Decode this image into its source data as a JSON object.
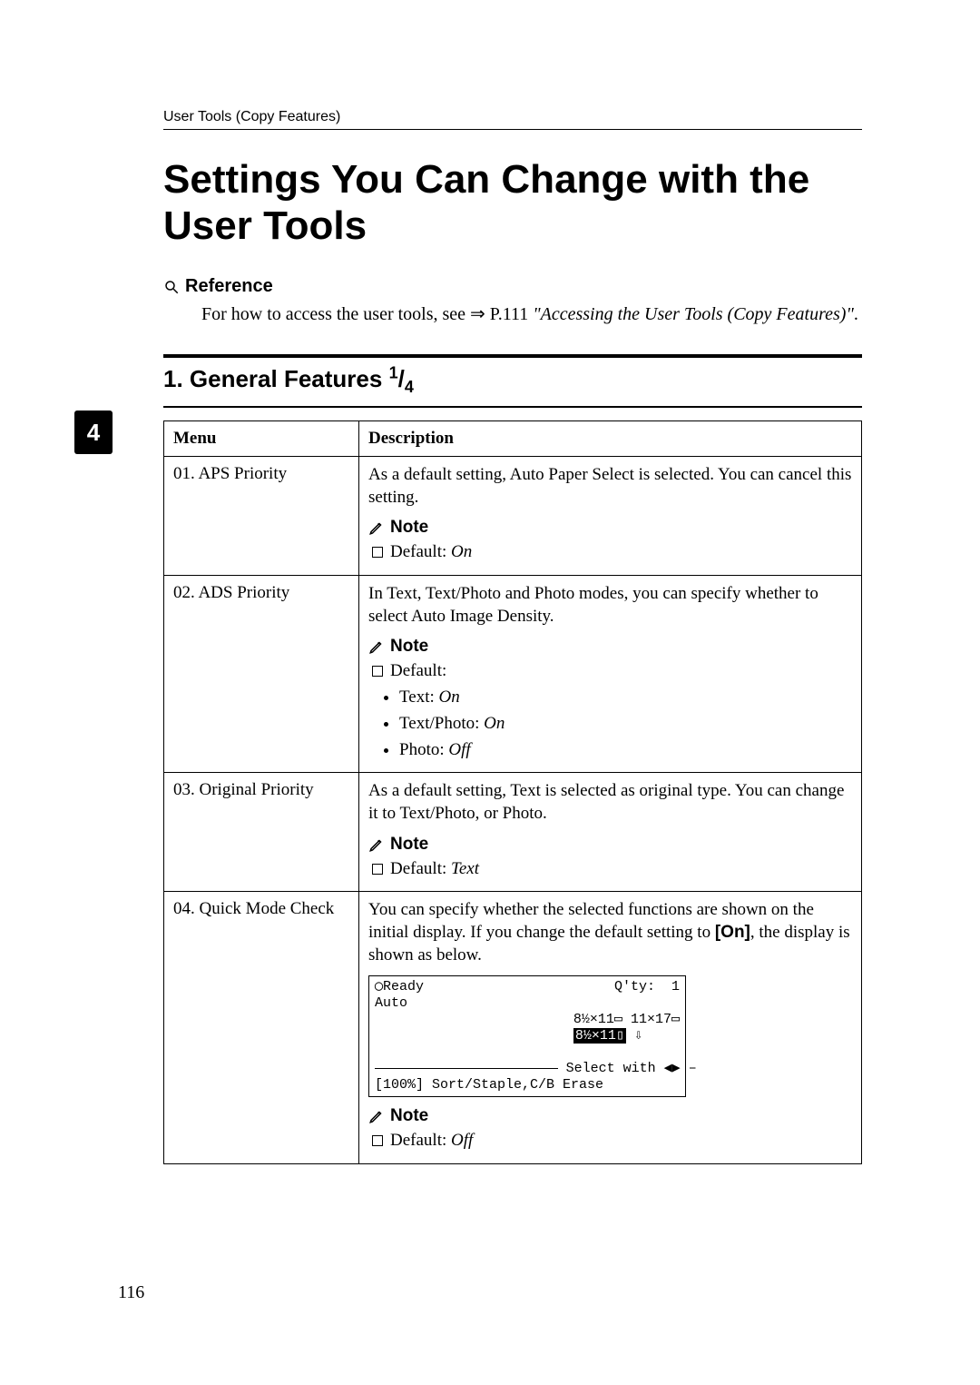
{
  "running_head": "User Tools (Copy Features)",
  "title": "Settings You Can Change with the User Tools",
  "reference": {
    "heading": "Reference",
    "body_prefix": "For how to access the user tools, see ⇒ P.111 ",
    "body_ital": "\"Accessing the User Tools (Copy Features)\"",
    "body_suffix": "."
  },
  "section": {
    "prefix": "1. General Features ",
    "sup": "1",
    "slash": "/",
    "sub": "4"
  },
  "side_tab": "4",
  "table": {
    "headers": {
      "menu": "Menu",
      "description": "Description"
    },
    "note_label": "Note",
    "rows": [
      {
        "menu": "01. APS Priority",
        "desc": "As a default setting, Auto Paper Select is selected. You can cancel this setting.",
        "default_label": "Default: ",
        "default_value": "On"
      },
      {
        "menu": "02. ADS Priority",
        "desc": "In Text, Text/Photo and Photo modes, you can specify whether to select Auto Image Density.",
        "default_label": "Default:",
        "bullets": [
          {
            "label": "Text: ",
            "value": "On"
          },
          {
            "label": "Text/Photo: ",
            "value": "On"
          },
          {
            "label": "Photo: ",
            "value": "Off"
          }
        ]
      },
      {
        "menu": "03. Original Priority",
        "desc": "As a default setting, Text is selected as original type. You can change it to Text/Photo, or Photo.",
        "default_label": "Default: ",
        "default_value": "Text"
      },
      {
        "menu": "04. Quick Mode Check",
        "desc_prefix": "You can specify whether the selected functions are shown on the initial display. If you change the default setting to ",
        "desc_bold": "[On]",
        "desc_suffix": ", the display is shown as below.",
        "lcd": {
          "line1_left": "◯Ready",
          "line1_right": "Q'ty:  1",
          "line2_left": "Auto",
          "line2_mid": "8½×11▭ 11×17▭",
          "line2_inv": "8½×11▯",
          "line2_tail": " ⇩",
          "line3": "Select with ◀▶",
          "line4": "[100%] Sort/Staple,C/B Erase"
        },
        "default_label": "Default: ",
        "default_value": "Off"
      }
    ]
  },
  "page_number": "116"
}
